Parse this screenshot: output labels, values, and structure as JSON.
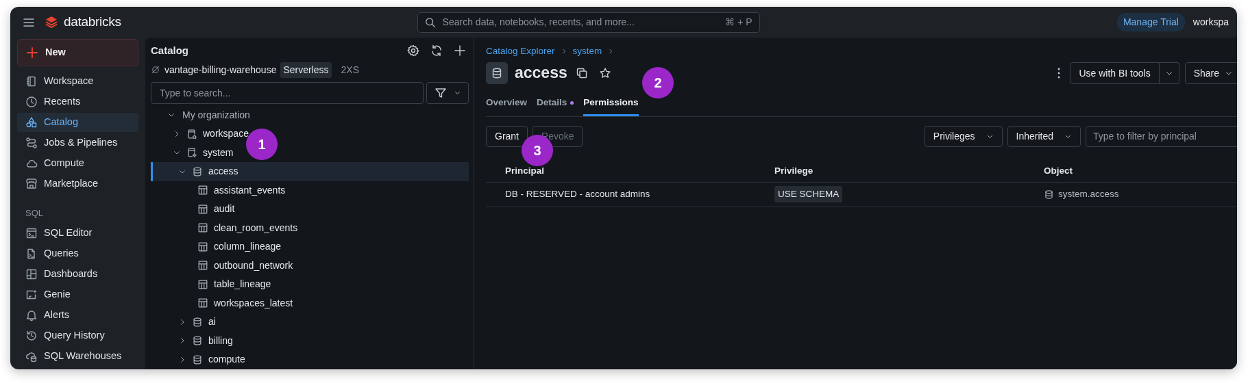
{
  "topbar": {
    "brand": "databricks",
    "search": {
      "placeholder": "Search data, notebooks, recents, and more...",
      "shortcut": "⌘ + P"
    },
    "manage_trial": "Manage Trial",
    "workspace": "workspa"
  },
  "nav": {
    "new_button": "New",
    "items": [
      {
        "label": "Workspace",
        "selected": false
      },
      {
        "label": "Recents",
        "selected": false
      },
      {
        "label": "Catalog",
        "selected": true
      },
      {
        "label": "Jobs & Pipelines",
        "selected": false
      },
      {
        "label": "Compute",
        "selected": false
      },
      {
        "label": "Marketplace",
        "selected": false
      }
    ],
    "sql_heading": "SQL",
    "sql_items": [
      {
        "label": "SQL Editor",
        "selected": false
      },
      {
        "label": "Queries",
        "selected": false
      },
      {
        "label": "Dashboards",
        "selected": false
      },
      {
        "label": "Genie",
        "selected": false
      },
      {
        "label": "Alerts",
        "selected": false
      },
      {
        "label": "Query History",
        "selected": false
      },
      {
        "label": "SQL Warehouses",
        "selected": false
      }
    ]
  },
  "catalog": {
    "title": "Catalog",
    "warehouse": {
      "name": "vantage-billing-warehouse",
      "type": "Serverless",
      "size": "2XS"
    },
    "search": {
      "placeholder": "Type to search..."
    },
    "tree": [
      {
        "label": "My organization",
        "kind": "group",
        "expanded": true,
        "selected": false,
        "children": [
          {
            "label": "workspace",
            "kind": "catalog",
            "expanded": false,
            "selected": false
          },
          {
            "label": "system",
            "kind": "catalog",
            "expanded": true,
            "selected": false,
            "children": [
              {
                "label": "access",
                "kind": "schema",
                "expanded": true,
                "selected": true,
                "children": [
                  {
                    "label": "assistant_events",
                    "kind": "table",
                    "selected": false
                  },
                  {
                    "label": "audit",
                    "kind": "table",
                    "selected": false
                  },
                  {
                    "label": "clean_room_events",
                    "kind": "table",
                    "selected": false
                  },
                  {
                    "label": "column_lineage",
                    "kind": "table",
                    "selected": false
                  },
                  {
                    "label": "outbound_network",
                    "kind": "table",
                    "selected": false
                  },
                  {
                    "label": "table_lineage",
                    "kind": "table",
                    "selected": false
                  },
                  {
                    "label": "workspaces_latest",
                    "kind": "table",
                    "selected": false
                  }
                ]
              },
              {
                "label": "ai",
                "kind": "schema",
                "expanded": false,
                "selected": false
              },
              {
                "label": "billing",
                "kind": "schema",
                "expanded": false,
                "selected": false
              },
              {
                "label": "compute",
                "kind": "schema",
                "expanded": false,
                "selected": false
              }
            ]
          }
        ]
      }
    ]
  },
  "main": {
    "breadcrumb": [
      "Catalog Explorer",
      "system"
    ],
    "title": "access",
    "actions": {
      "bi_tools": "Use with BI tools",
      "share": "Share"
    },
    "tabs": [
      {
        "label": "Overview",
        "selected": false,
        "dot": false
      },
      {
        "label": "Details",
        "selected": false,
        "dot": true
      },
      {
        "label": "Permissions",
        "selected": true,
        "dot": false
      }
    ],
    "toolbar": {
      "buttons": [
        {
          "label": "Grant",
          "disabled": false
        },
        {
          "label": "Revoke",
          "disabled": true
        }
      ],
      "filters": [
        "Privileges",
        "Inherited"
      ],
      "filter_placeholder": "Type to filter by principal"
    },
    "table": {
      "columns": [
        "Principal",
        "Privilege",
        "Object"
      ],
      "rows": [
        {
          "principal": "DB - RESERVED - account admins",
          "privilege": "USE SCHEMA",
          "object": "system.access"
        }
      ]
    }
  },
  "callouts": [
    "1",
    "2",
    "3"
  ]
}
